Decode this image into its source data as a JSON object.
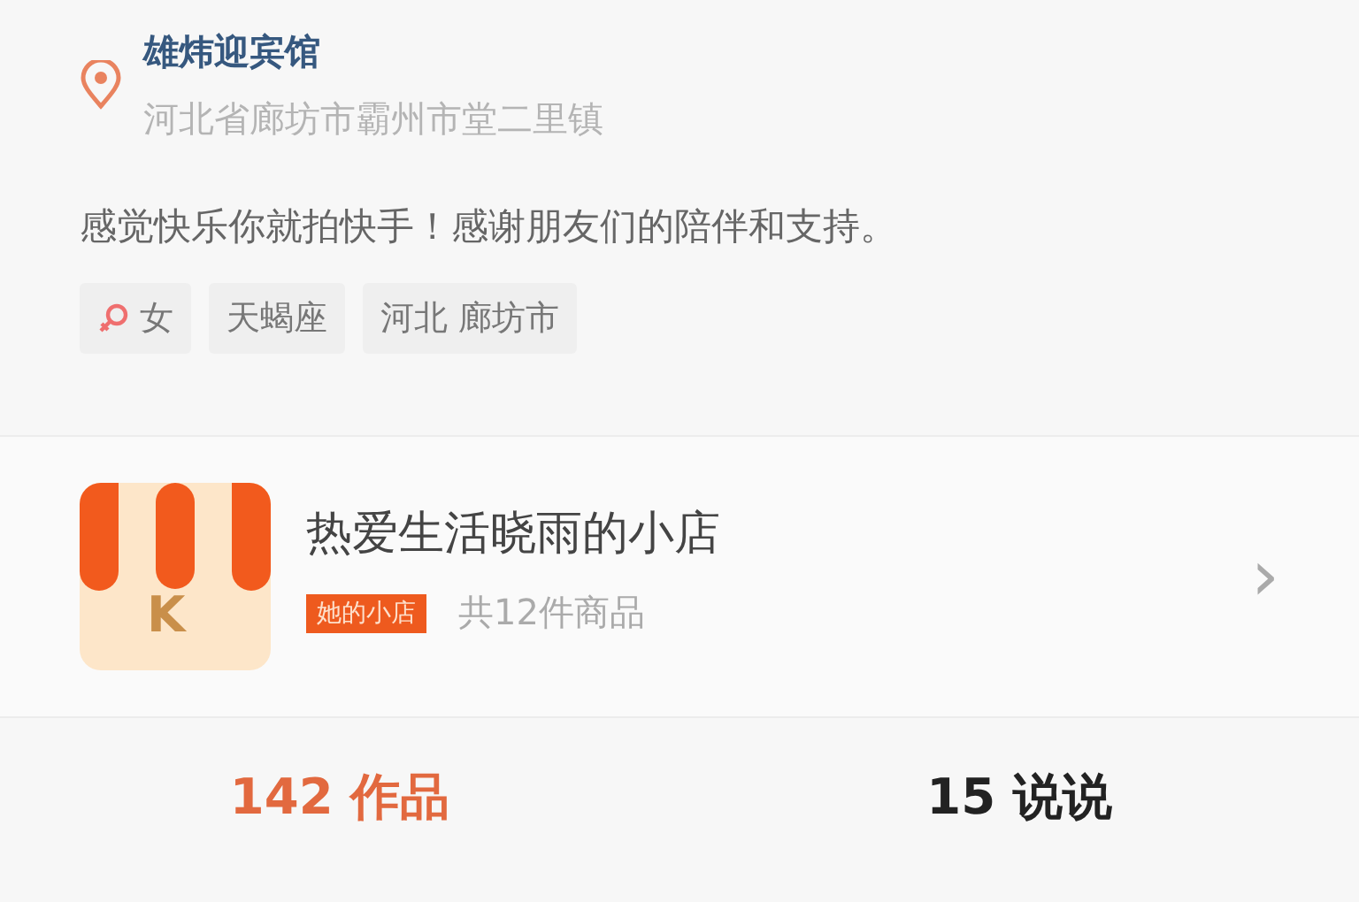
{
  "location": {
    "name": "雄炜迎宾馆",
    "address": "河北省廊坊市霸州市堂二里镇"
  },
  "bio": "感觉快乐你就拍快手！感谢朋友们的陪伴和支持。",
  "tags": [
    {
      "kind": "gender",
      "label": "女"
    },
    {
      "kind": "text",
      "label": "天蝎座"
    },
    {
      "kind": "text",
      "label": "河北 廊坊市"
    }
  ],
  "shop": {
    "logo_letter": "K",
    "name": "热爱生活晓雨的小店",
    "badge": "她的小店",
    "count": "共12件商品",
    "arrow": "›"
  },
  "tabs": [
    {
      "label": "142 作品",
      "selected": true
    },
    {
      "label": "15 说说",
      "selected": false
    }
  ]
}
